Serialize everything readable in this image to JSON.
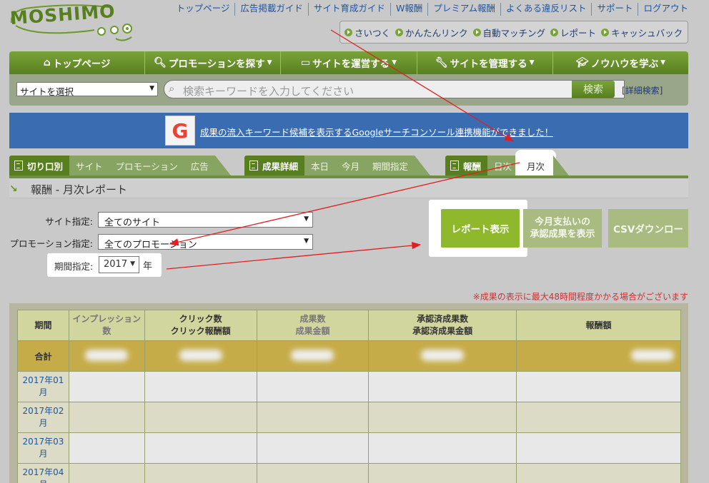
{
  "header": {
    "logo_text": "MOSHIMO",
    "top_links": [
      "トップページ",
      "広告掲載ガイド",
      "サイト育成ガイド",
      "W報酬",
      "プレミアム報酬",
      "よくある違反リスト",
      "サポート",
      "ログアウト"
    ],
    "quick_links": [
      "さいつく",
      "かんたんリンク",
      "自動マッチング",
      "レポート",
      "キャッシュバック"
    ]
  },
  "nav": {
    "items": [
      {
        "label": "トップページ",
        "icon": "⌂",
        "dropdown": ""
      },
      {
        "label": "プロモーションを探す",
        "icon": "🔍︎",
        "dropdown": "▼"
      },
      {
        "label": "サイトを運営する",
        "icon": "▭",
        "dropdown": "▼"
      },
      {
        "label": "サイトを管理する",
        "icon": "🔧︎",
        "dropdown": "▼"
      },
      {
        "label": "ノウハウを学ぶ",
        "icon": "🎓︎",
        "dropdown": "▼"
      }
    ]
  },
  "search": {
    "site_select": "サイトを選択",
    "placeholder": "検索キーワードを入力してください",
    "button": "検索",
    "advanced": "[詳細検索]"
  },
  "banner": {
    "text": "成果の流入キーワード候補を表示するGoogleサーチコンソール連携機能ができました！",
    "icon_letter": "G"
  },
  "tabs": {
    "group1": {
      "head": "切り口別",
      "items": [
        "サイト",
        "プロモーション",
        "広告"
      ]
    },
    "group2": {
      "head": "成果詳細",
      "items": [
        "本日",
        "今月",
        "期間指定"
      ]
    },
    "group3": {
      "head": "報酬",
      "items": [
        "日次",
        "月次"
      ],
      "selected": "月次"
    }
  },
  "section_title": "報酬 - 月次レポート",
  "form": {
    "site_label": "サイト指定:",
    "site_value": "全てのサイト",
    "promo_label": "プロモーション指定:",
    "promo_value": "全てのプロモーション",
    "period_label": "期間指定:",
    "period_value": "2017",
    "period_unit": "年"
  },
  "buttons": {
    "report": "レポート表示",
    "approve_line1": "今月支払いの",
    "approve_line2": "承認成果を表示",
    "csv": "CSVダウンロー"
  },
  "notice": "※成果の表示に最大48時間程度かかる場合がございます",
  "table": {
    "headers": [
      {
        "line1": "期間",
        "line2": ""
      },
      {
        "line1": "インプレッション",
        "line2": "数"
      },
      {
        "line1": "クリック数",
        "line2": "クリック報酬額"
      },
      {
        "line1": "成果数",
        "line2": "成果金額"
      },
      {
        "line1": "承認済成果数",
        "line2": "承認済成果金額"
      },
      {
        "line1": "報酬額",
        "line2": ""
      }
    ],
    "total_label": "合計",
    "rows": [
      {
        "line1": "2017年01",
        "line2": "月"
      },
      {
        "line1": "2017年02",
        "line2": "月"
      },
      {
        "line1": "2017年03",
        "line2": "月"
      },
      {
        "line1": "2017年04",
        "line2": "月"
      }
    ]
  },
  "colors": {
    "brand_green": "#587f1f",
    "annotation_red": "#e02020",
    "banner_blue": "#3a6cb2"
  }
}
